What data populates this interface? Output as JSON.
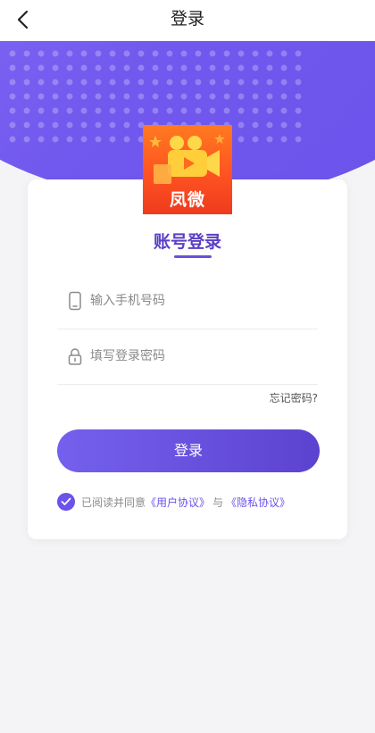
{
  "nav": {
    "title": "登录",
    "back_icon": "chevron-left-icon"
  },
  "logo": {
    "text": "凤微"
  },
  "card": {
    "title": "账号登录",
    "phone": {
      "placeholder": "输入手机号码",
      "icon": "phone-icon"
    },
    "password": {
      "placeholder": "填写登录密码",
      "icon": "lock-icon"
    },
    "forgot": "忘记密码?",
    "login_button": "登录",
    "agreement": {
      "checked": true,
      "prefix": "已阅读并同意",
      "user_agreement": "《用户协议》",
      "connector": "与",
      "privacy_agreement": "《隐私协议》"
    }
  },
  "colors": {
    "accent": "#6a52ea",
    "hero_start": "#8d72f5",
    "logo_orange": "#ff5322"
  }
}
